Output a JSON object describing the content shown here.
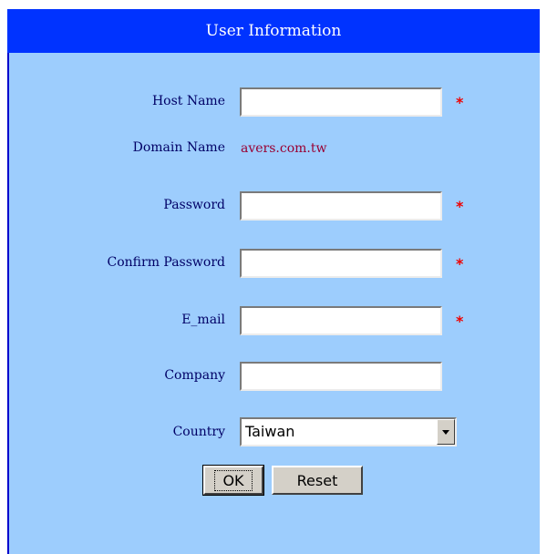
{
  "header": {
    "title": "User Information"
  },
  "fields": {
    "host_name": {
      "label": "Host Name",
      "value": "",
      "required": "*"
    },
    "domain_name": {
      "label": "Domain Name",
      "value": "avers.com.tw"
    },
    "password": {
      "label": "Password",
      "value": "",
      "required": "*"
    },
    "confirm_password": {
      "label": "Confirm Password",
      "value": "",
      "required": "*"
    },
    "email": {
      "label": "E_mail",
      "value": "",
      "required": "*"
    },
    "company": {
      "label": "Company",
      "value": ""
    },
    "country": {
      "label": "Country",
      "selected": "Taiwan"
    }
  },
  "buttons": {
    "ok": "OK",
    "reset": "Reset"
  },
  "colors": {
    "header_bg": "#0033ff",
    "panel_bg": "#9dcdfd",
    "label": "#000066",
    "domain_value": "#990033",
    "required": "#ee0000"
  },
  "icons": {
    "dropdown": "chevron-down-icon"
  }
}
